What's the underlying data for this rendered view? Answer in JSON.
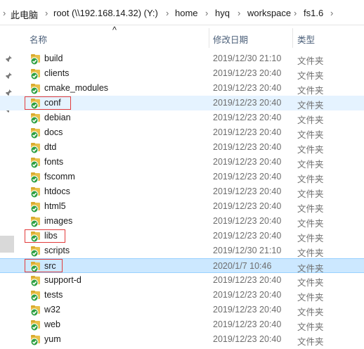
{
  "breadcrumb": [
    "此电脑",
    "root (\\\\192.168.14.32) (Y:)",
    "home",
    "hyq",
    "workspace",
    "fs1.6"
  ],
  "columns": {
    "name": "名称",
    "date": "修改日期",
    "type": "类型"
  },
  "rows": [
    {
      "name": "build",
      "date": "2019/12/30 21:10",
      "type": "文件夹"
    },
    {
      "name": "clients",
      "date": "2019/12/23 20:40",
      "type": "文件夹"
    },
    {
      "name": "cmake_modules",
      "date": "2019/12/23 20:40",
      "type": "文件夹"
    },
    {
      "name": "conf",
      "date": "2019/12/23 20:40",
      "type": "文件夹"
    },
    {
      "name": "debian",
      "date": "2019/12/23 20:40",
      "type": "文件夹"
    },
    {
      "name": "docs",
      "date": "2019/12/23 20:40",
      "type": "文件夹"
    },
    {
      "name": "dtd",
      "date": "2019/12/23 20:40",
      "type": "文件夹"
    },
    {
      "name": "fonts",
      "date": "2019/12/23 20:40",
      "type": "文件夹"
    },
    {
      "name": "fscomm",
      "date": "2019/12/23 20:40",
      "type": "文件夹"
    },
    {
      "name": "htdocs",
      "date": "2019/12/23 20:40",
      "type": "文件夹"
    },
    {
      "name": "html5",
      "date": "2019/12/23 20:40",
      "type": "文件夹"
    },
    {
      "name": "images",
      "date": "2019/12/23 20:40",
      "type": "文件夹"
    },
    {
      "name": "libs",
      "date": "2019/12/23 20:40",
      "type": "文件夹"
    },
    {
      "name": "scripts",
      "date": "2019/12/30 21:10",
      "type": "文件夹"
    },
    {
      "name": "src",
      "date": "2020/1/7 10:46",
      "type": "文件夹"
    },
    {
      "name": "support-d",
      "date": "2019/12/23 20:40",
      "type": "文件夹"
    },
    {
      "name": "tests",
      "date": "2019/12/23 20:40",
      "type": "文件夹"
    },
    {
      "name": "w32",
      "date": "2019/12/23 20:40",
      "type": "文件夹"
    },
    {
      "name": "web",
      "date": "2019/12/23 20:40",
      "type": "文件夹"
    },
    {
      "name": "yum",
      "date": "2019/12/23 20:40",
      "type": "文件夹"
    }
  ],
  "icons": {
    "folder": "folder-synced-icon",
    "pin": "pin-icon",
    "sort": "sort-ascending-icon"
  },
  "colors": {
    "selected_row": "#e5f3ff",
    "highlight_row": "#cce8ff",
    "annotation_box": "#e23b3b",
    "folder": "#e8c04a",
    "sync_check": "#2ea043"
  }
}
